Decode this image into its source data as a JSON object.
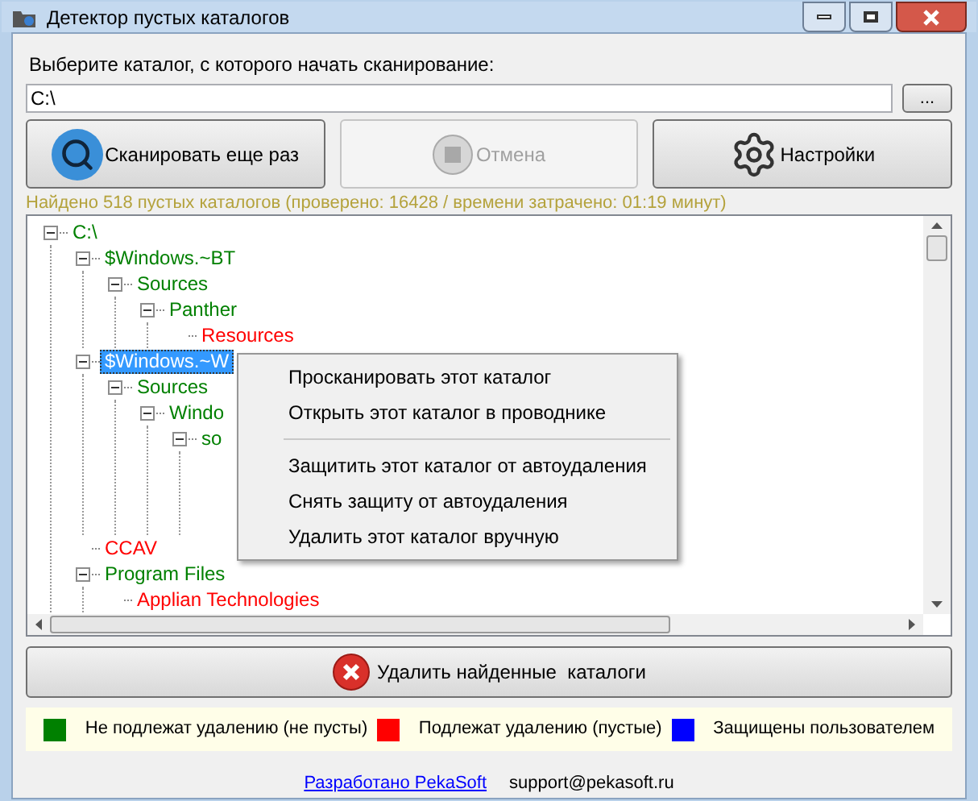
{
  "window": {
    "title": "Детектор пустых каталогов"
  },
  "path_label": "Выберите каталог, с которого начать сканирование:",
  "path_field": {
    "value": "C:\\"
  },
  "browse_button": "...",
  "buttons": [
    {
      "kind": "scan",
      "label": "Сканировать еще раз",
      "disabled": false
    },
    {
      "kind": "stop",
      "label": "Отмена",
      "disabled": true
    },
    {
      "kind": "settings",
      "label": "Настройки",
      "disabled": false
    }
  ],
  "status": "Найдено 518 пустых каталогов (проверено: 16428 / времени затрачено: 01:19 минут)",
  "tree": [
    {
      "label": "C:\\",
      "color": "#008000",
      "selected": false,
      "expanded": true,
      "children": [
        {
          "label": "$Windows.~BT",
          "color": "#008000",
          "selected": false,
          "expanded": true,
          "children": [
            {
              "label": "Sources",
              "color": "#008000",
              "selected": false,
              "expanded": true,
              "children": [
                {
                  "label": "Panther",
                  "color": "#008000",
                  "selected": false,
                  "expanded": true,
                  "children": [
                    {
                      "label": "Resources",
                      "color": "#ff0000",
                      "selected": false
                    }
                  ]
                }
              ]
            }
          ]
        },
        {
          "label": "$Windows.~W",
          "selected": true,
          "expanded": true,
          "children": [
            {
              "label": "Sources",
              "color": "#008000",
              "selected": false,
              "expanded": true,
              "children": [
                {
                  "label": "Windo",
                  "color": "#008000",
                  "selected": false,
                  "expanded": true,
                  "children": [
                    {
                      "label": "so",
                      "color": "#008000",
                      "selected": false,
                      "expanded": true
                    }
                  ]
                }
              ]
            }
          ]
        },
        {
          "label": "CCAV",
          "color": "#ff0000",
          "selected": false
        },
        {
          "label": "Program Files",
          "color": "#008000",
          "selected": false,
          "expanded": true,
          "children": [
            {
              "label": "Applian Technologies",
              "color": "#ff0000",
              "selected": false
            }
          ]
        }
      ]
    }
  ],
  "context_menu": [
    {
      "kind": "item",
      "label": "Просканировать этот каталог"
    },
    {
      "kind": "item",
      "label": "Открыть этот каталог в проводнике"
    },
    {
      "kind": "separator"
    },
    {
      "kind": "item",
      "label": "Защитить этот каталог от автоудаления"
    },
    {
      "kind": "item",
      "label": "Снять защиту от автоудаления"
    },
    {
      "kind": "item",
      "label": "Удалить этот каталог вручную"
    }
  ],
  "delete_button": "Удалить найденные  каталоги",
  "legend": [
    {
      "color": "#008000",
      "label": "Не подлежат удалению (не пусты)"
    },
    {
      "color": "#ff0000",
      "label": "Подлежат удалению (пустые)"
    },
    {
      "color": "#0000ff",
      "label": "Защищены пользователем"
    }
  ],
  "footer": {
    "link": "Разработано PekaSoft",
    "email": "support@pekasoft.ru"
  }
}
